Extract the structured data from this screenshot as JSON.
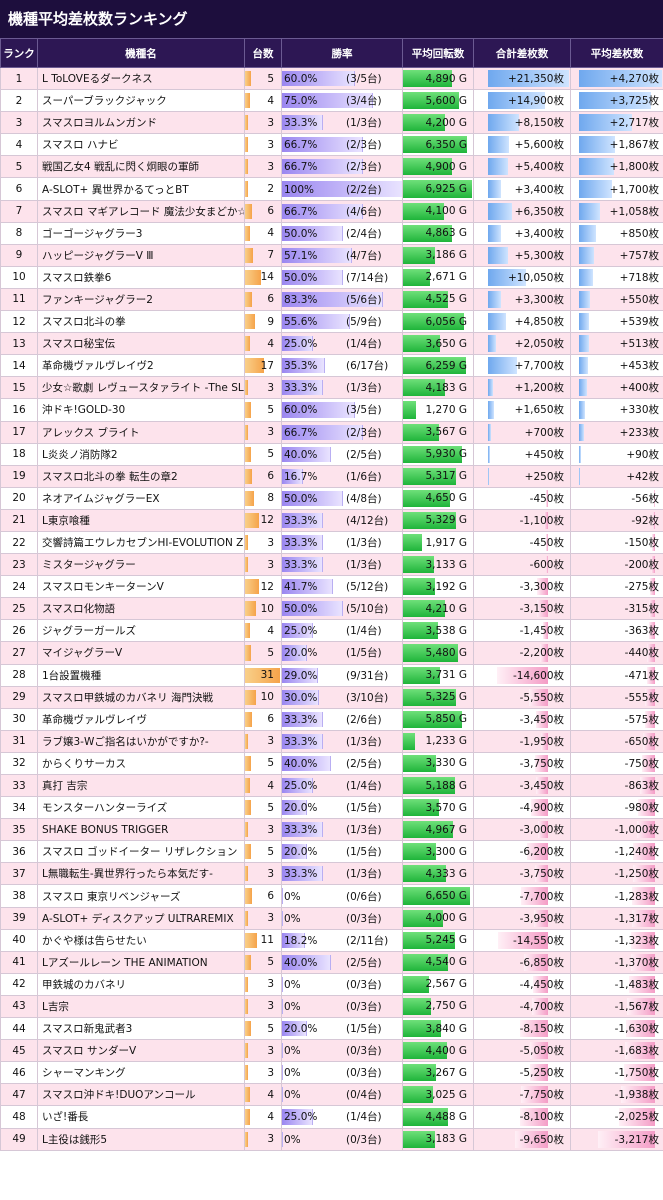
{
  "title": "機種平均差枚数ランキング",
  "headers": {
    "rank": "ランク",
    "name": "機種名",
    "count": "台数",
    "win_rate": "勝率",
    "avg_spins": "平均回転数",
    "total_diff": "合計差枚数",
    "avg_diff": "平均差枚数"
  },
  "colors": {
    "title_bg": "#1d0e3d",
    "header_bg": "#2d1754",
    "row_pink": "#fde3ec",
    "count_bar": "#f5a34a",
    "win_bar": "#9a86f0",
    "spins_bar": "#1fb43a",
    "positive_bar": "#6fa8ee",
    "negative_bar": "#f49cc6"
  },
  "rows": [
    {
      "rank": "1",
      "name": "L ToLOVEるダークネス",
      "count": "5",
      "count_num": 5,
      "win_rate": "60.0%",
      "win_detail": "(3/5台)",
      "win_num": 60.0,
      "spins": "4,890 G",
      "spins_num": 4890,
      "total": "+21,350枚",
      "total_num": 21350,
      "avg": "+4,270枚",
      "avg_num": 4270
    },
    {
      "rank": "2",
      "name": "スーパーブラックジャック",
      "count": "4",
      "count_num": 4,
      "win_rate": "75.0%",
      "win_detail": "(3/4台)",
      "win_num": 75.0,
      "spins": "5,600 G",
      "spins_num": 5600,
      "total": "+14,900枚",
      "total_num": 14900,
      "avg": "+3,725枚",
      "avg_num": 3725
    },
    {
      "rank": "3",
      "name": "スマスロヨルムンガンド",
      "count": "3",
      "count_num": 3,
      "win_rate": "33.3%",
      "win_detail": "(1/3台)",
      "win_num": 33.3,
      "spins": "4,200 G",
      "spins_num": 4200,
      "total": "+8,150枚",
      "total_num": 8150,
      "avg": "+2,717枚",
      "avg_num": 2717
    },
    {
      "rank": "4",
      "name": "スマスロ ハナビ",
      "count": "3",
      "count_num": 3,
      "win_rate": "66.7%",
      "win_detail": "(2/3台)",
      "win_num": 66.7,
      "spins": "6,350 G",
      "spins_num": 6350,
      "total": "+5,600枚",
      "total_num": 5600,
      "avg": "+1,867枚",
      "avg_num": 1867
    },
    {
      "rank": "5",
      "name": "戦国乙女4 戦乱に閃く炯眼の軍師",
      "count": "3",
      "count_num": 3,
      "win_rate": "66.7%",
      "win_detail": "(2/3台)",
      "win_num": 66.7,
      "spins": "4,900 G",
      "spins_num": 4900,
      "total": "+5,400枚",
      "total_num": 5400,
      "avg": "+1,800枚",
      "avg_num": 1800
    },
    {
      "rank": "6",
      "name": "A-SLOT+ 異世界かるてっとBT",
      "count": "2",
      "count_num": 2,
      "win_rate": "100%",
      "win_detail": "(2/2台)",
      "win_num": 100,
      "spins": "6,925 G",
      "spins_num": 6925,
      "total": "+3,400枚",
      "total_num": 3400,
      "avg": "+1,700枚",
      "avg_num": 1700
    },
    {
      "rank": "7",
      "name": "スマスロ マギアレコード 魔法少女まどか☆マギカ外伝",
      "count": "6",
      "count_num": 6,
      "win_rate": "66.7%",
      "win_detail": "(4/6台)",
      "win_num": 66.7,
      "spins": "4,100 G",
      "spins_num": 4100,
      "total": "+6,350枚",
      "total_num": 6350,
      "avg": "+1,058枚",
      "avg_num": 1058
    },
    {
      "rank": "8",
      "name": "ゴーゴージャグラー3",
      "count": "4",
      "count_num": 4,
      "win_rate": "50.0%",
      "win_detail": "(2/4台)",
      "win_num": 50.0,
      "spins": "4,863 G",
      "spins_num": 4863,
      "total": "+3,400枚",
      "total_num": 3400,
      "avg": "+850枚",
      "avg_num": 850
    },
    {
      "rank": "9",
      "name": "ハッピージャグラーV Ⅲ",
      "count": "7",
      "count_num": 7,
      "win_rate": "57.1%",
      "win_detail": "(4/7台)",
      "win_num": 57.1,
      "spins": "3,186 G",
      "spins_num": 3186,
      "total": "+5,300枚",
      "total_num": 5300,
      "avg": "+757枚",
      "avg_num": 757
    },
    {
      "rank": "10",
      "name": "スマスロ鉄拳6",
      "count": "14",
      "count_num": 14,
      "win_rate": "50.0%",
      "win_detail": "(7/14台)",
      "win_num": 50.0,
      "spins": "2,671 G",
      "spins_num": 2671,
      "total": "+10,050枚",
      "total_num": 10050,
      "avg": "+718枚",
      "avg_num": 718
    },
    {
      "rank": "11",
      "name": "ファンキージャグラー2",
      "count": "6",
      "count_num": 6,
      "win_rate": "83.3%",
      "win_detail": "(5/6台)",
      "win_num": 83.3,
      "spins": "4,525 G",
      "spins_num": 4525,
      "total": "+3,300枚",
      "total_num": 3300,
      "avg": "+550枚",
      "avg_num": 550
    },
    {
      "rank": "12",
      "name": "スマスロ北斗の拳",
      "count": "9",
      "count_num": 9,
      "win_rate": "55.6%",
      "win_detail": "(5/9台)",
      "win_num": 55.6,
      "spins": "6,056 G",
      "spins_num": 6056,
      "total": "+4,850枚",
      "total_num": 4850,
      "avg": "+539枚",
      "avg_num": 539
    },
    {
      "rank": "13",
      "name": "スマスロ秘宝伝",
      "count": "4",
      "count_num": 4,
      "win_rate": "25.0%",
      "win_detail": "(1/4台)",
      "win_num": 25.0,
      "spins": "3,650 G",
      "spins_num": 3650,
      "total": "+2,050枚",
      "total_num": 2050,
      "avg": "+513枚",
      "avg_num": 513
    },
    {
      "rank": "14",
      "name": "革命機ヴァルヴレイヴ2",
      "count": "17",
      "count_num": 17,
      "win_rate": "35.3%",
      "win_detail": "(6/17台)",
      "win_num": 35.3,
      "spins": "6,259 G",
      "spins_num": 6259,
      "total": "+7,700枚",
      "total_num": 7700,
      "avg": "+453枚",
      "avg_num": 453
    },
    {
      "rank": "15",
      "name": "少女☆歌劇 レヴュースタァライト -The SLOT-",
      "count": "3",
      "count_num": 3,
      "win_rate": "33.3%",
      "win_detail": "(1/3台)",
      "win_num": 33.3,
      "spins": "4,183 G",
      "spins_num": 4183,
      "total": "+1,200枚",
      "total_num": 1200,
      "avg": "+400枚",
      "avg_num": 400
    },
    {
      "rank": "16",
      "name": "沖ドキ!GOLD-30",
      "count": "5",
      "count_num": 5,
      "win_rate": "60.0%",
      "win_detail": "(3/5台)",
      "win_num": 60.0,
      "spins": "1,270 G",
      "spins_num": 1270,
      "total": "+1,650枚",
      "total_num": 1650,
      "avg": "+330枚",
      "avg_num": 330
    },
    {
      "rank": "17",
      "name": "アレックス ブライト",
      "count": "3",
      "count_num": 3,
      "win_rate": "66.7%",
      "win_detail": "(2/3台)",
      "win_num": 66.7,
      "spins": "3,567 G",
      "spins_num": 3567,
      "total": "+700枚",
      "total_num": 700,
      "avg": "+233枚",
      "avg_num": 233
    },
    {
      "rank": "18",
      "name": "L炎炎ノ消防隊2",
      "count": "5",
      "count_num": 5,
      "win_rate": "40.0%",
      "win_detail": "(2/5台)",
      "win_num": 40.0,
      "spins": "5,930 G",
      "spins_num": 5930,
      "total": "+450枚",
      "total_num": 450,
      "avg": "+90枚",
      "avg_num": 90
    },
    {
      "rank": "19",
      "name": "スマスロ北斗の拳 転生の章2",
      "count": "6",
      "count_num": 6,
      "win_rate": "16.7%",
      "win_detail": "(1/6台)",
      "win_num": 16.7,
      "spins": "5,317 G",
      "spins_num": 5317,
      "total": "+250枚",
      "total_num": 250,
      "avg": "+42枚",
      "avg_num": 42
    },
    {
      "rank": "20",
      "name": "ネオアイムジャグラーEX",
      "count": "8",
      "count_num": 8,
      "win_rate": "50.0%",
      "win_detail": "(4/8台)",
      "win_num": 50.0,
      "spins": "4,650 G",
      "spins_num": 4650,
      "total": "-450枚",
      "total_num": -450,
      "avg": "-56枚",
      "avg_num": -56
    },
    {
      "rank": "21",
      "name": "L東京喰種",
      "count": "12",
      "count_num": 12,
      "win_rate": "33.3%",
      "win_detail": "(4/12台)",
      "win_num": 33.3,
      "spins": "5,329 G",
      "spins_num": 5329,
      "total": "-1,100枚",
      "total_num": -1100,
      "avg": "-92枚",
      "avg_num": -92
    },
    {
      "rank": "22",
      "name": "交響詩篇エウレカセブンHI-EVOLUTION ZERO",
      "count": "3",
      "count_num": 3,
      "win_rate": "33.3%",
      "win_detail": "(1/3台)",
      "win_num": 33.3,
      "spins": "1,917 G",
      "spins_num": 1917,
      "total": "-450枚",
      "total_num": -450,
      "avg": "-150枚",
      "avg_num": -150
    },
    {
      "rank": "23",
      "name": "ミスタージャグラー",
      "count": "3",
      "count_num": 3,
      "win_rate": "33.3%",
      "win_detail": "(1/3台)",
      "win_num": 33.3,
      "spins": "3,133 G",
      "spins_num": 3133,
      "total": "-600枚",
      "total_num": -600,
      "avg": "-200枚",
      "avg_num": -200
    },
    {
      "rank": "24",
      "name": "スマスロモンキーターンV",
      "count": "12",
      "count_num": 12,
      "win_rate": "41.7%",
      "win_detail": "(5/12台)",
      "win_num": 41.7,
      "spins": "3,192 G",
      "spins_num": 3192,
      "total": "-3,300枚",
      "total_num": -3300,
      "avg": "-275枚",
      "avg_num": -275
    },
    {
      "rank": "25",
      "name": "スマスロ化物語",
      "count": "10",
      "count_num": 10,
      "win_rate": "50.0%",
      "win_detail": "(5/10台)",
      "win_num": 50.0,
      "spins": "4,210 G",
      "spins_num": 4210,
      "total": "-3,150枚",
      "total_num": -3150,
      "avg": "-315枚",
      "avg_num": -315
    },
    {
      "rank": "26",
      "name": "ジャグラーガールズ",
      "count": "4",
      "count_num": 4,
      "win_rate": "25.0%",
      "win_detail": "(1/4台)",
      "win_num": 25.0,
      "spins": "3,538 G",
      "spins_num": 3538,
      "total": "-1,450枚",
      "total_num": -1450,
      "avg": "-363枚",
      "avg_num": -363
    },
    {
      "rank": "27",
      "name": "マイジャグラーV",
      "count": "5",
      "count_num": 5,
      "win_rate": "20.0%",
      "win_detail": "(1/5台)",
      "win_num": 20.0,
      "spins": "5,480 G",
      "spins_num": 5480,
      "total": "-2,200枚",
      "total_num": -2200,
      "avg": "-440枚",
      "avg_num": -440
    },
    {
      "rank": "28",
      "name": "1台設置機種",
      "count": "31",
      "count_num": 31,
      "win_rate": "29.0%",
      "win_detail": "(9/31台)",
      "win_num": 29.0,
      "spins": "3,731 G",
      "spins_num": 3731,
      "total": "-14,600枚",
      "total_num": -14600,
      "avg": "-471枚",
      "avg_num": -471
    },
    {
      "rank": "29",
      "name": "スマスロ甲鉄城のカバネリ 海門決戦",
      "count": "10",
      "count_num": 10,
      "win_rate": "30.0%",
      "win_detail": "(3/10台)",
      "win_num": 30.0,
      "spins": "5,325 G",
      "spins_num": 5325,
      "total": "-5,550枚",
      "total_num": -5550,
      "avg": "-555枚",
      "avg_num": -555
    },
    {
      "rank": "30",
      "name": "革命機ヴァルヴレイヴ",
      "count": "6",
      "count_num": 6,
      "win_rate": "33.3%",
      "win_detail": "(2/6台)",
      "win_num": 33.3,
      "spins": "5,850 G",
      "spins_num": 5850,
      "total": "-3,450枚",
      "total_num": -3450,
      "avg": "-575枚",
      "avg_num": -575
    },
    {
      "rank": "31",
      "name": "ラブ嬢3-Wご指名はいかがですか?-",
      "count": "3",
      "count_num": 3,
      "win_rate": "33.3%",
      "win_detail": "(1/3台)",
      "win_num": 33.3,
      "spins": "1,233 G",
      "spins_num": 1233,
      "total": "-1,950枚",
      "total_num": -1950,
      "avg": "-650枚",
      "avg_num": -650
    },
    {
      "rank": "32",
      "name": "からくりサーカス",
      "count": "5",
      "count_num": 5,
      "win_rate": "40.0%",
      "win_detail": "(2/5台)",
      "win_num": 40.0,
      "spins": "3,330 G",
      "spins_num": 3330,
      "total": "-3,750枚",
      "total_num": -3750,
      "avg": "-750枚",
      "avg_num": -750
    },
    {
      "rank": "33",
      "name": "真打 吉宗",
      "count": "4",
      "count_num": 4,
      "win_rate": "25.0%",
      "win_detail": "(1/4台)",
      "win_num": 25.0,
      "spins": "5,188 G",
      "spins_num": 5188,
      "total": "-3,450枚",
      "total_num": -3450,
      "avg": "-863枚",
      "avg_num": -863
    },
    {
      "rank": "34",
      "name": "モンスターハンターライズ",
      "count": "5",
      "count_num": 5,
      "win_rate": "20.0%",
      "win_detail": "(1/5台)",
      "win_num": 20.0,
      "spins": "3,570 G",
      "spins_num": 3570,
      "total": "-4,900枚",
      "total_num": -4900,
      "avg": "-980枚",
      "avg_num": -980
    },
    {
      "rank": "35",
      "name": "SHAKE BONUS TRIGGER",
      "count": "3",
      "count_num": 3,
      "win_rate": "33.3%",
      "win_detail": "(1/3台)",
      "win_num": 33.3,
      "spins": "4,967 G",
      "spins_num": 4967,
      "total": "-3,000枚",
      "total_num": -3000,
      "avg": "-1,000枚",
      "avg_num": -1000
    },
    {
      "rank": "36",
      "name": "スマスロ ゴッドイーター リザレクション",
      "count": "5",
      "count_num": 5,
      "win_rate": "20.0%",
      "win_detail": "(1/5台)",
      "win_num": 20.0,
      "spins": "3,300 G",
      "spins_num": 3300,
      "total": "-6,200枚",
      "total_num": -6200,
      "avg": "-1,240枚",
      "avg_num": -1240
    },
    {
      "rank": "37",
      "name": "L無職転生-異世界行ったら本気だす-",
      "count": "3",
      "count_num": 3,
      "win_rate": "33.3%",
      "win_detail": "(1/3台)",
      "win_num": 33.3,
      "spins": "4,333 G",
      "spins_num": 4333,
      "total": "-3,750枚",
      "total_num": -3750,
      "avg": "-1,250枚",
      "avg_num": -1250
    },
    {
      "rank": "38",
      "name": "スマスロ 東京リベンジャーズ",
      "count": "6",
      "count_num": 6,
      "win_rate": "0%",
      "win_detail": "(0/6台)",
      "win_num": 0,
      "spins": "6,650 G",
      "spins_num": 6650,
      "total": "-7,700枚",
      "total_num": -7700,
      "avg": "-1,283枚",
      "avg_num": -1283
    },
    {
      "rank": "39",
      "name": "A-SLOT+ ディスクアップ ULTRAREMIX",
      "count": "3",
      "count_num": 3,
      "win_rate": "0%",
      "win_detail": "(0/3台)",
      "win_num": 0,
      "spins": "4,000 G",
      "spins_num": 4000,
      "total": "-3,950枚",
      "total_num": -3950,
      "avg": "-1,317枚",
      "avg_num": -1317
    },
    {
      "rank": "40",
      "name": "かぐや様は告らせたい",
      "count": "11",
      "count_num": 11,
      "win_rate": "18.2%",
      "win_detail": "(2/11台)",
      "win_num": 18.2,
      "spins": "5,245 G",
      "spins_num": 5245,
      "total": "-14,550枚",
      "total_num": -14550,
      "avg": "-1,323枚",
      "avg_num": -1323
    },
    {
      "rank": "41",
      "name": "Lアズールレーン THE ANIMATION",
      "count": "5",
      "count_num": 5,
      "win_rate": "40.0%",
      "win_detail": "(2/5台)",
      "win_num": 40.0,
      "spins": "4,540 G",
      "spins_num": 4540,
      "total": "-6,850枚",
      "total_num": -6850,
      "avg": "-1,370枚",
      "avg_num": -1370
    },
    {
      "rank": "42",
      "name": "甲鉄城のカバネリ",
      "count": "3",
      "count_num": 3,
      "win_rate": "0%",
      "win_detail": "(0/3台)",
      "win_num": 0,
      "spins": "2,567 G",
      "spins_num": 2567,
      "total": "-4,450枚",
      "total_num": -4450,
      "avg": "-1,483枚",
      "avg_num": -1483
    },
    {
      "rank": "43",
      "name": "L吉宗",
      "count": "3",
      "count_num": 3,
      "win_rate": "0%",
      "win_detail": "(0/3台)",
      "win_num": 0,
      "spins": "2,750 G",
      "spins_num": 2750,
      "total": "-4,700枚",
      "total_num": -4700,
      "avg": "-1,567枚",
      "avg_num": -1567
    },
    {
      "rank": "44",
      "name": "スマスロ新鬼武者3",
      "count": "5",
      "count_num": 5,
      "win_rate": "20.0%",
      "win_detail": "(1/5台)",
      "win_num": 20.0,
      "spins": "3,840 G",
      "spins_num": 3840,
      "total": "-8,150枚",
      "total_num": -8150,
      "avg": "-1,630枚",
      "avg_num": -1630
    },
    {
      "rank": "45",
      "name": "スマスロ サンダーV",
      "count": "3",
      "count_num": 3,
      "win_rate": "0%",
      "win_detail": "(0/3台)",
      "win_num": 0,
      "spins": "4,400 G",
      "spins_num": 4400,
      "total": "-5,050枚",
      "total_num": -5050,
      "avg": "-1,683枚",
      "avg_num": -1683
    },
    {
      "rank": "46",
      "name": "シャーマンキング",
      "count": "3",
      "count_num": 3,
      "win_rate": "0%",
      "win_detail": "(0/3台)",
      "win_num": 0,
      "spins": "3,267 G",
      "spins_num": 3267,
      "total": "-5,250枚",
      "total_num": -5250,
      "avg": "-1,750枚",
      "avg_num": -1750
    },
    {
      "rank": "47",
      "name": "スマスロ沖ドキ!DUOアンコール",
      "count": "4",
      "count_num": 4,
      "win_rate": "0%",
      "win_detail": "(0/4台)",
      "win_num": 0,
      "spins": "3,025 G",
      "spins_num": 3025,
      "total": "-7,750枚",
      "total_num": -7750,
      "avg": "-1,938枚",
      "avg_num": -1938
    },
    {
      "rank": "48",
      "name": "いざ!番長",
      "count": "4",
      "count_num": 4,
      "win_rate": "25.0%",
      "win_detail": "(1/4台)",
      "win_num": 25.0,
      "spins": "4,488 G",
      "spins_num": 4488,
      "total": "-8,100枚",
      "total_num": -8100,
      "avg": "-2,025枚",
      "avg_num": -2025
    },
    {
      "rank": "49",
      "name": "L主役は銭形5",
      "count": "3",
      "count_num": 3,
      "win_rate": "0%",
      "win_detail": "(0/3台)",
      "win_num": 0,
      "spins": "3,183 G",
      "spins_num": 3183,
      "total": "-9,650枚",
      "total_num": -9650,
      "avg": "-3,217枚",
      "avg_num": -3217
    }
  ]
}
